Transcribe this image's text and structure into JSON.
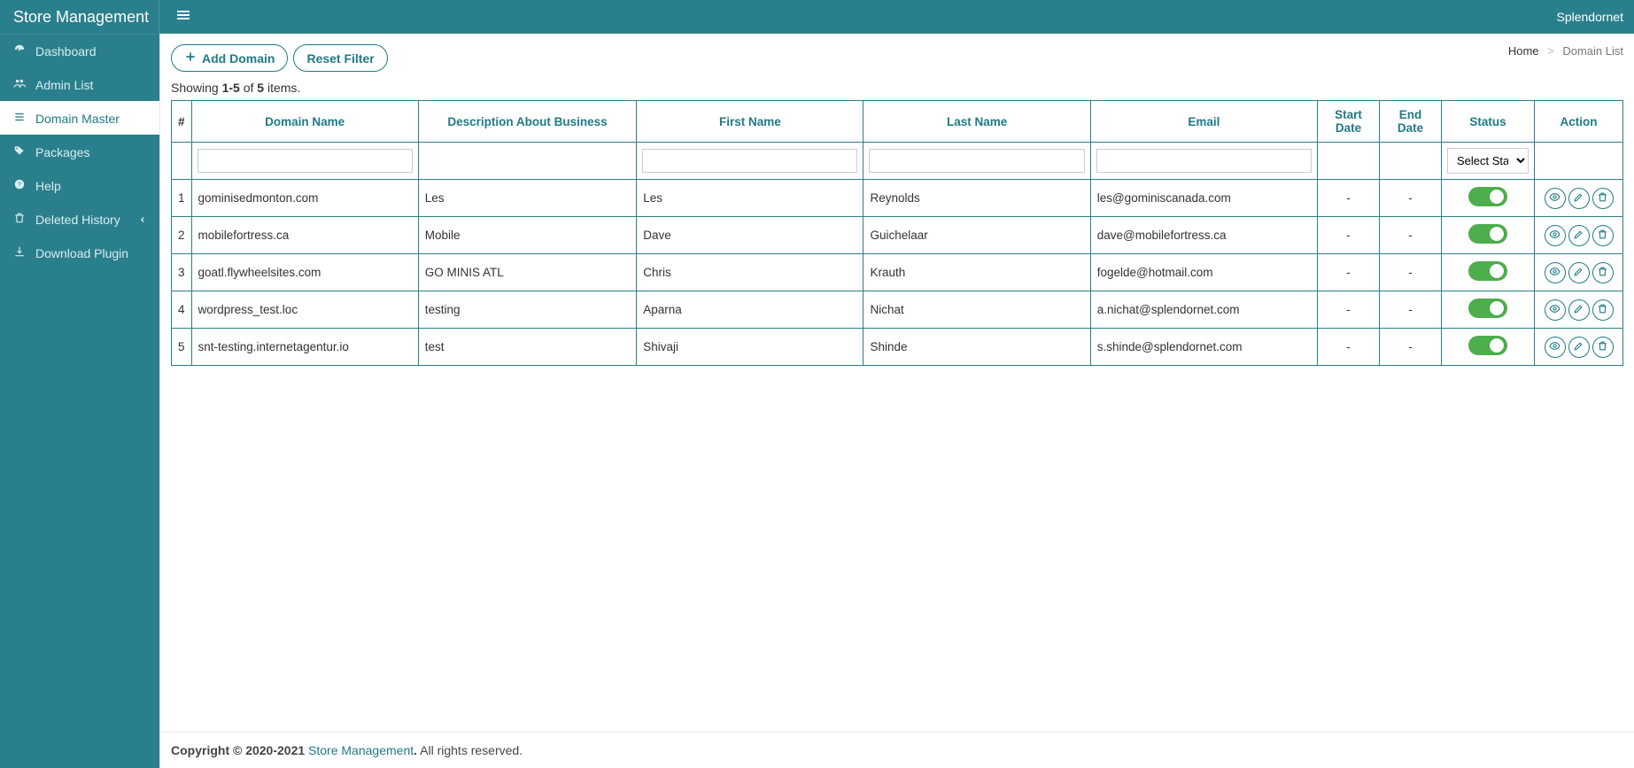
{
  "header": {
    "brand": "Store Management",
    "user": "Splendornet"
  },
  "sidebar": {
    "items": [
      {
        "icon": "dashboard-icon",
        "label": "Dashboard"
      },
      {
        "icon": "users-icon",
        "label": "Admin List"
      },
      {
        "icon": "list-icon",
        "label": "Domain Master",
        "active": true
      },
      {
        "icon": "tag-icon",
        "label": "Packages"
      },
      {
        "icon": "help-icon",
        "label": "Help"
      },
      {
        "icon": "trash-icon",
        "label": "Deleted History",
        "caret": true
      },
      {
        "icon": "download-icon",
        "label": "Download Plugin"
      }
    ]
  },
  "toolbar": {
    "add_label": "Add Domain",
    "reset_label": "Reset Filter"
  },
  "breadcrumb": {
    "home": "Home",
    "current": "Domain List"
  },
  "summary": {
    "prefix": "Showing ",
    "range": "1-5",
    "mid": " of ",
    "total": "5",
    "suffix": " items."
  },
  "table": {
    "headers": {
      "num": "#",
      "domain": "Domain Name",
      "desc": "Description About Business",
      "first": "First Name",
      "last": "Last Name",
      "email": "Email",
      "start": "Start Date",
      "end": "End Date",
      "status": "Status",
      "action": "Action"
    },
    "filter": {
      "status_placeholder": "Select Status"
    },
    "rows": [
      {
        "n": "1",
        "domain": "gominisedmonton.com",
        "desc": "Les",
        "first": "Les",
        "last": "Reynolds",
        "email": "les@gominiscanada.com",
        "start": "-",
        "end": "-",
        "status": "on"
      },
      {
        "n": "2",
        "domain": "mobilefortress.ca",
        "desc": "Mobile",
        "first": "Dave",
        "last": "Guichelaar",
        "email": "dave@mobilefortress.ca",
        "start": "-",
        "end": "-",
        "status": "on"
      },
      {
        "n": "3",
        "domain": "goatl.flywheelsites.com",
        "desc": "GO MINIS ATL",
        "first": "Chris",
        "last": "Krauth",
        "email": "fogelde@hotmail.com",
        "start": "-",
        "end": "-",
        "status": "on"
      },
      {
        "n": "4",
        "domain": "wordpress_test.loc",
        "desc": "testing",
        "first": "Aparna",
        "last": "Nichat",
        "email": "a.nichat@splendornet.com",
        "start": "-",
        "end": "-",
        "status": "on"
      },
      {
        "n": "5",
        "domain": "snt-testing.internetagentur.io",
        "desc": "test",
        "first": "Shivaji",
        "last": "Shinde",
        "email": "s.shinde@splendornet.com",
        "start": "-",
        "end": "-",
        "status": "on"
      }
    ]
  },
  "footer": {
    "copyright": "Copyright © 2020-2021 ",
    "brand": "Store Management",
    "period": ".",
    "rights": " All rights reserved."
  }
}
